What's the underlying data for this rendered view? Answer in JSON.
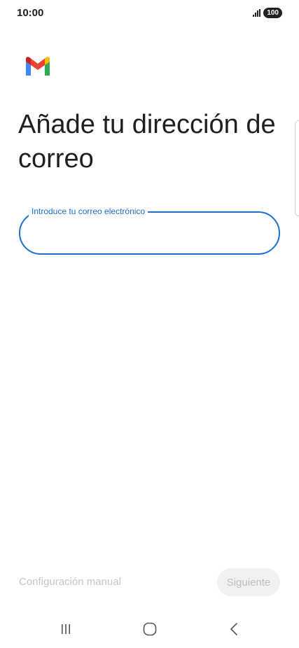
{
  "status_bar": {
    "time": "10:00",
    "battery": "100"
  },
  "logo": {
    "icon": "gmail-logo-icon"
  },
  "title": "Añade tu dirección de correo",
  "email_field": {
    "label": "Introduce tu correo electrónico",
    "value": "",
    "focused": true
  },
  "actions": {
    "manual_config": "Configuración manual",
    "next": "Siguiente"
  },
  "navigation": {
    "recent": "recent-apps-icon",
    "home": "home-icon",
    "back": "back-icon"
  },
  "colors": {
    "accent": "#1a6fcf",
    "disabled_text": "#c6c6c6",
    "disabled_button_bg": "#f1f1f1"
  }
}
